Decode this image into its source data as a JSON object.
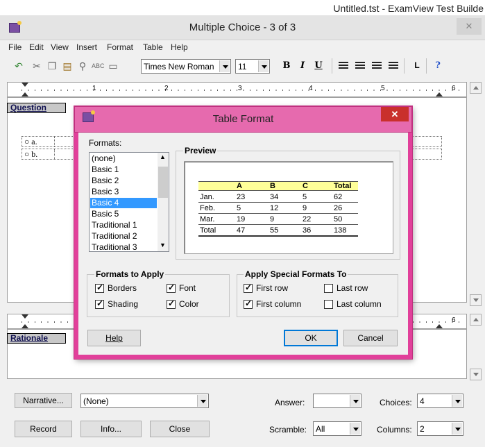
{
  "background_window": {
    "title": "Untitled.tst - ExamView Test Builde"
  },
  "window": {
    "title": "Multiple Choice - 3 of 3",
    "close_glyph": "✕"
  },
  "menu": [
    "File",
    "Edit",
    "View",
    "Insert",
    "Format",
    "Table",
    "Help"
  ],
  "toolbar": {
    "font_name": "Times New Roman",
    "font_size": "11",
    "bold": "B",
    "italic": "I",
    "underline": "U",
    "help_glyph": "?"
  },
  "ruler": {
    "numbers_top": [
      "1",
      "2",
      "3",
      "4",
      "5",
      "6"
    ],
    "numbers_bottom": [
      "6"
    ]
  },
  "question": {
    "label": "Question",
    "choices": [
      "a.",
      "b."
    ]
  },
  "rationale": {
    "label": "Rationale"
  },
  "bottom": {
    "narrative_button": "Narrative...",
    "narrative_value": "(None)",
    "answer_label": "Answer:",
    "answer_value": "",
    "choices_label": "Choices:",
    "choices_value": "4",
    "record_button": "Record",
    "info_button": "Info...",
    "close_button": "Close",
    "scramble_label": "Scramble:",
    "scramble_value": "All",
    "columns_label": "Columns:",
    "columns_value": "2"
  },
  "dialog": {
    "title": "Table Format",
    "close_glyph": "✕",
    "formats_label": "Formats:",
    "formats": [
      "(none)",
      "Basic 1",
      "Basic 2",
      "Basic 3",
      "Basic 4",
      "Basic 5",
      "Traditional 1",
      "Traditional 2",
      "Traditional 3"
    ],
    "selected_format": "Basic 4",
    "preview_label": "Preview",
    "preview_table": {
      "header": [
        "",
        "A",
        "B",
        "C",
        "Total"
      ],
      "rows": [
        [
          "Jan.",
          "23",
          "34",
          "5",
          "62"
        ],
        [
          "Feb.",
          "5",
          "12",
          "9",
          "26"
        ],
        [
          "Mar.",
          "19",
          "9",
          "22",
          "50"
        ],
        [
          "Total",
          "47",
          "55",
          "36",
          "138"
        ]
      ],
      "header_color": "#ffff99"
    },
    "apply_group_label": "Formats to Apply",
    "apply": [
      {
        "label": "Borders",
        "checked": true
      },
      {
        "label": "Font",
        "checked": true
      },
      {
        "label": "Shading",
        "checked": true
      },
      {
        "label": "Color",
        "checked": true
      }
    ],
    "special_group_label": "Apply Special Formats To",
    "special": [
      {
        "label": "First row",
        "checked": true
      },
      {
        "label": "Last row",
        "checked": false
      },
      {
        "label": "First column",
        "checked": true
      },
      {
        "label": "Last column",
        "checked": false
      }
    ],
    "help_button": "Help",
    "ok_button": "OK",
    "cancel_button": "Cancel",
    "accent_color": "#e1409a"
  }
}
